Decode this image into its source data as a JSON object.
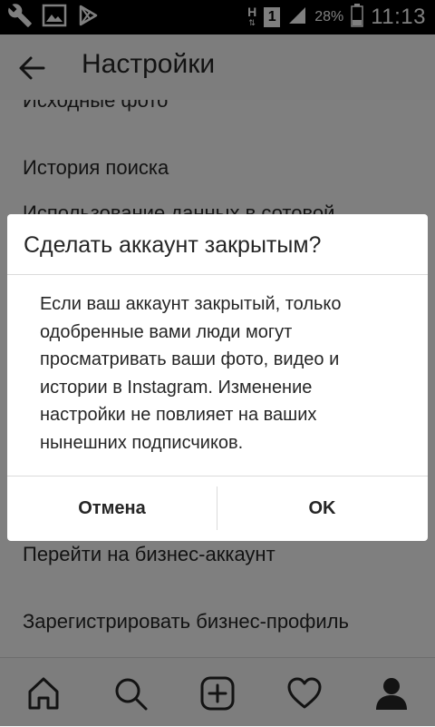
{
  "status_bar": {
    "left_icons": [
      "wrench-icon",
      "image-icon",
      "play-store-icon"
    ],
    "network_label": "H",
    "sim_label": "1",
    "battery": "28%",
    "time": "11:13"
  },
  "header": {
    "title": "Настройки"
  },
  "settings_list": {
    "items": [
      "Исходные фото",
      "История поиска",
      "Использование данных в сотовой",
      "Перейти на бизнес-аккаунт",
      "Зарегистрировать бизнес-профиль"
    ]
  },
  "dialog": {
    "title": "Сделать аккаунт закрытым?",
    "message": "Если ваш аккаунт закрытый, только одобренные вами люди могут просматривать ваши фото, видео и истории в Instagram. Изменение настройки не повлияет на ваших нынешних подписчиков.",
    "cancel_label": "Отмена",
    "ok_label": "OK"
  },
  "bottom_nav": {
    "items": [
      "home-icon",
      "search-icon",
      "new-post-icon",
      "activity-heart-icon",
      "profile-icon"
    ]
  }
}
